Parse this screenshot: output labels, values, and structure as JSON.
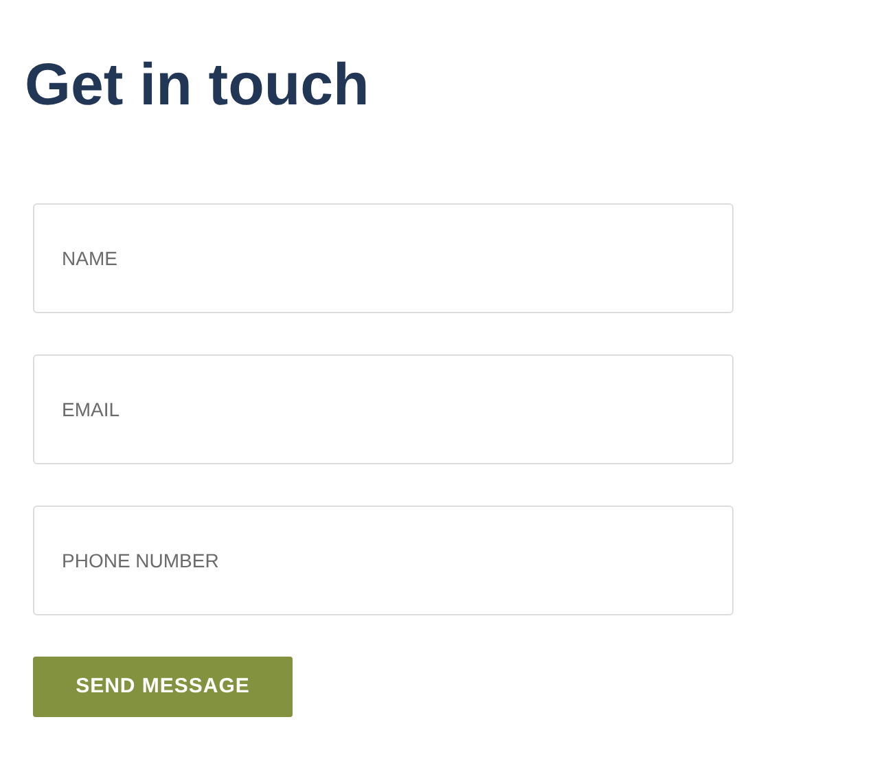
{
  "heading": "Get in touch",
  "fields": [
    {
      "placeholder": "NAME"
    },
    {
      "placeholder": "EMAIL"
    },
    {
      "placeholder": "PHONE NUMBER"
    }
  ],
  "submit_button": "SEND MESSAGE"
}
